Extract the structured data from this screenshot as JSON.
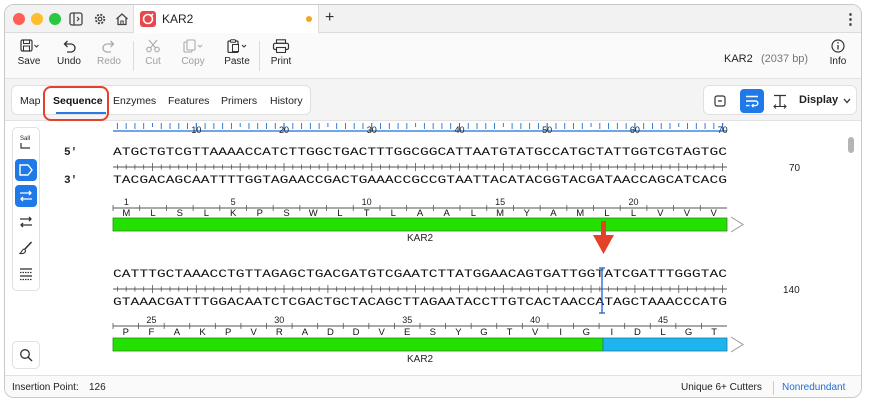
{
  "tab": {
    "title": "KAR2"
  },
  "toolbar": {
    "save": "Save",
    "undo": "Undo",
    "redo": "Redo",
    "cut": "Cut",
    "copy": "Copy",
    "paste": "Paste",
    "print": "Print",
    "info": "Info"
  },
  "document": {
    "name": "KAR2",
    "size": "(2037 bp)"
  },
  "view_tabs": [
    "Map",
    "Sequence",
    "Enzymes",
    "Features",
    "Primers",
    "History"
  ],
  "active_view_tab": "Sequence",
  "display_label": "Display",
  "sidebar": {
    "enzyme_label": "SalI"
  },
  "sequence": {
    "labels": {
      "five_prime": "5'",
      "three_prime": "3'"
    },
    "row1": {
      "ruler": [
        "10",
        "20",
        "30",
        "40",
        "50",
        "60",
        "70"
      ],
      "top_strand": "ATGCTGTCGTTAAAACCATCTTGGCTGACTTTGGCGGCATTAATGTATGCCATGCTATTGGTCGTAGTGC",
      "bottom_strand": "TACGACAGCAATTTTGGTAGAACCGACTGAAACCGCCGTAATTACATACGGTACGATAACCAGCATCACG",
      "end_number": "70",
      "aa_numbers": [
        "1",
        "5",
        "10",
        "15",
        "20"
      ],
      "translation": [
        "M",
        "L",
        "S",
        "L",
        "K",
        "P",
        "S",
        "W",
        "L",
        "T",
        "L",
        "A",
        "A",
        "L",
        "M",
        "Y",
        "A",
        "M",
        "L",
        "L",
        "V",
        "V",
        "V"
      ],
      "feature_label": "KAR2"
    },
    "row2": {
      "top_strand": "CATTTGCTAAACCTGTTAGAGCTGACGATGTCGAATCTTATGGAACAGTGATTGGTATCGATTTGGGTAC",
      "bottom_strand": "GTAAACGATTTGGACAATCTCGACTGCTACAGCTTAGAATACCTTGTCACTAACCATAGCTAAACCCATG",
      "end_number": "140",
      "aa_numbers": [
        "25",
        "30",
        "35",
        "40",
        "45"
      ],
      "translation": [
        "P",
        "F",
        "A",
        "K",
        "P",
        "V",
        "R",
        "A",
        "D",
        "D",
        "V",
        "E",
        "S",
        "Y",
        "G",
        "T",
        "V",
        "I",
        "G",
        "I",
        "D",
        "L",
        "G",
        "T"
      ],
      "feature_label": "KAR2"
    }
  },
  "colors": {
    "feature_green": "#22e000",
    "feature_blue": "#1eb4ee",
    "accent": "#1f79e6",
    "annotation_red": "#e5402a"
  },
  "status": {
    "insertion_point_label": "Insertion Point:",
    "insertion_point_value": "126",
    "cutters": "Unique 6+ Cutters",
    "nonredundant": "Nonredundant"
  }
}
